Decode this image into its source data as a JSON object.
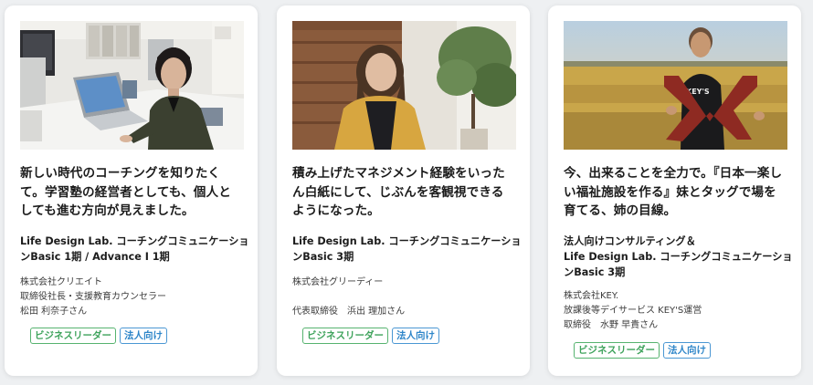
{
  "cards": [
    {
      "headline": [
        "新しい時代のコーチングを知りたく",
        "て。学習塾の経営者としても、個人と",
        "しても進む方向が見えました。"
      ],
      "program": [
        "Life Design Lab. コーチングコミュニケーショ",
        "ンBasic 1期 / Advance I 1期"
      ],
      "company": [
        "株式会社クリエイト",
        "取締役社長・支援教育カウンセラー",
        "松田 利奈子さん"
      ],
      "tags": [
        "ビジネスリーダー",
        "法人向け"
      ]
    },
    {
      "headline": [
        "積み上げたマネジメント経験をいった",
        "ん白紙にして、じぶんを客観視できる",
        "ようになった。"
      ],
      "program": [
        "Life Design Lab. コーチングコミュニケーショ",
        "ンBasic 3期"
      ],
      "company": [
        "株式会社グリーディー",
        "",
        "代表取締役　浜出 理加さん"
      ],
      "tags": [
        "ビジネスリーダー",
        "法人向け"
      ]
    },
    {
      "headline": [
        "今、出来ることを全力で。『日本一楽し",
        "い福祉施設を作る』妹とタッグで場を",
        "育てる、姉の目線。"
      ],
      "program": [
        "法人向けコンサルティング＆",
        "Life Design Lab. コーチングコミュニケーショ",
        "ンBasic 3期"
      ],
      "company": [
        "株式会社KEY.",
        "放課後等デイサービス KEY'S運営",
        "取締役　水野 早貴さん"
      ],
      "tags": [
        "ビジネスリーダー",
        "法人向け"
      ]
    }
  ],
  "photo3": {
    "shirt_text": "KEY'S"
  },
  "colors": {
    "tag_green": "#3fa35c",
    "tag_blue": "#2f86c9",
    "background": "#eef0f2"
  }
}
